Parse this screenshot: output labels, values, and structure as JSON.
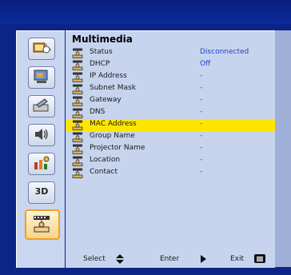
{
  "menu": {
    "title": "Multimedia",
    "sidebar": [
      {
        "name": "image-settings",
        "icon": "image-settings-icon"
      },
      {
        "name": "display-settings",
        "icon": "display-icon"
      },
      {
        "name": "setup",
        "icon": "setup-icon"
      },
      {
        "name": "audio",
        "icon": "audio-icon"
      },
      {
        "name": "options",
        "icon": "options-icon"
      },
      {
        "name": "3d",
        "icon": "3d-icon",
        "text": "3D"
      },
      {
        "name": "multimedia",
        "icon": "network-icon",
        "active": true
      }
    ],
    "rows": [
      {
        "label": "Status",
        "value": "Disconnected"
      },
      {
        "label": "DHCP",
        "value": "Off"
      },
      {
        "label": "IP Address",
        "value": "-"
      },
      {
        "label": "Subnet Mask",
        "value": "-"
      },
      {
        "label": "Gateway",
        "value": "-"
      },
      {
        "label": "DNS",
        "value": "-"
      },
      {
        "label": "MAC Address",
        "value": "-",
        "highlight": true
      },
      {
        "label": "Group Name",
        "value": "-"
      },
      {
        "label": "Projector Name",
        "value": "-"
      },
      {
        "label": "Location",
        "value": "-"
      },
      {
        "label": "Contact",
        "value": "-"
      }
    ],
    "footer": {
      "select_label": "Select",
      "enter_label": "Enter",
      "exit_label": "Exit",
      "menu_key_label": "Menu"
    }
  },
  "colors": {
    "background": "#0c2486",
    "panel": "#c7d4ee",
    "highlight": "#ffe600",
    "value_text": "#2440c8",
    "active_border": "#f0a020"
  }
}
